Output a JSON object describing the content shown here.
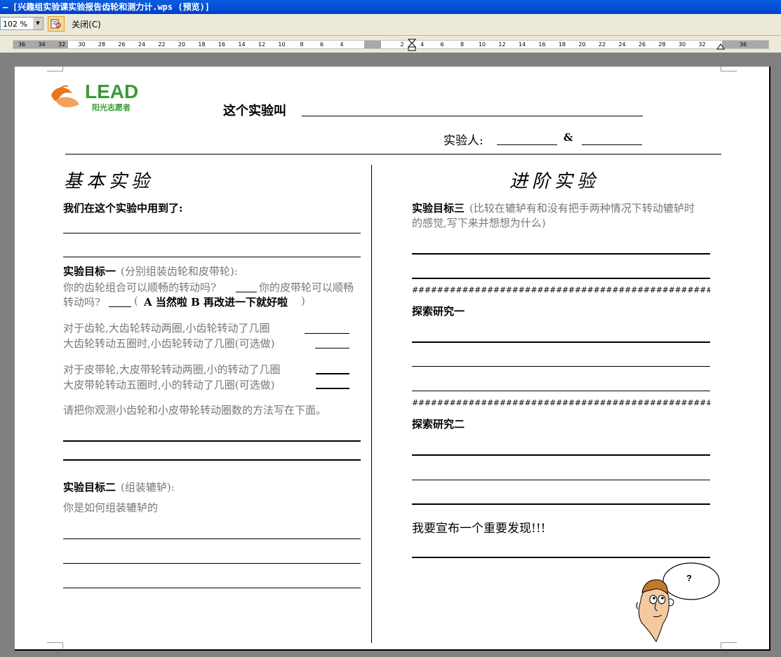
{
  "window": {
    "title": "[兴趣组实验课实验报告齿轮和测力计.wps (预览)]",
    "system_icon": "–"
  },
  "toolbar": {
    "zoom_value": "102 %",
    "print_icon": "print-preview-icon",
    "close_label": "关闭(C)"
  },
  "ruler": {
    "left_ticks": [
      "36",
      "34",
      "32",
      "30",
      "28",
      "26",
      "24",
      "22",
      "20",
      "18",
      "16",
      "14",
      "12",
      "10",
      "8",
      "6",
      "4"
    ],
    "right_ticks": [
      "2",
      "4",
      "6",
      "8",
      "10",
      "12",
      "14",
      "16",
      "18",
      "20",
      "22",
      "24",
      "26",
      "28",
      "30",
      "32",
      "36"
    ]
  },
  "header": {
    "logo_text": "LEAD",
    "logo_subtitle": "阳光志愿者",
    "experiment_name_label": "这个实验叫",
    "experimenter_label": "实验人:",
    "ampersand": "&"
  },
  "left": {
    "heading": "基本实验",
    "used_label": "我们在这个实验中用到了:",
    "goal1_title": "实验目标一",
    "goal1_desc": "(分别组装齿轮和皮带轮):",
    "goal1_q1": "你的齿轮组合可以顺畅的转动吗?",
    "goal1_q2": "你的皮带轮可以顺畅",
    "goal1_q3": "转动吗?",
    "goal1_options_open": "(",
    "goal1_options": "A 当然啦   B 再改进一下就好啦",
    "goal1_options_close": ")",
    "gear_q1": "对于齿轮,大齿轮转动两圈,小齿轮转动了几圈",
    "gear_q2": "大齿轮转动五圈时,小齿轮转动了几圈(可选做)",
    "belt_q1": "对于皮带轮,大皮带轮转动两圈,小的转动了几圈",
    "belt_q2": "大皮带轮转动五圈时,小的转动了几圈(可选做)",
    "method_prompt": "请把你观测小齿轮和小皮带轮转动圈数的方法写在下面。",
    "goal2_title": "实验目标二",
    "goal2_desc": "(组装辘轳):",
    "goal2_q": "你是如何组装辘轳的"
  },
  "right": {
    "heading": "进阶实验",
    "goal3_title": "实验目标三",
    "goal3_desc1": "(比较在辘轳有和没有把手两种情况下转动辘轳时",
    "goal3_desc2": "的感觉,写下来并想想为什么)",
    "hash_line": "##################################################################################",
    "explore1": "探索研究一",
    "explore2": "探索研究二",
    "announce": "我要宣布一个重要发现!!!",
    "thought_mark": "?"
  },
  "colors": {
    "titlebar": "#0a5ddf",
    "logo_green": "#3a9a3a",
    "logo_orange": "#e8741e",
    "gray_text": "#777777"
  }
}
